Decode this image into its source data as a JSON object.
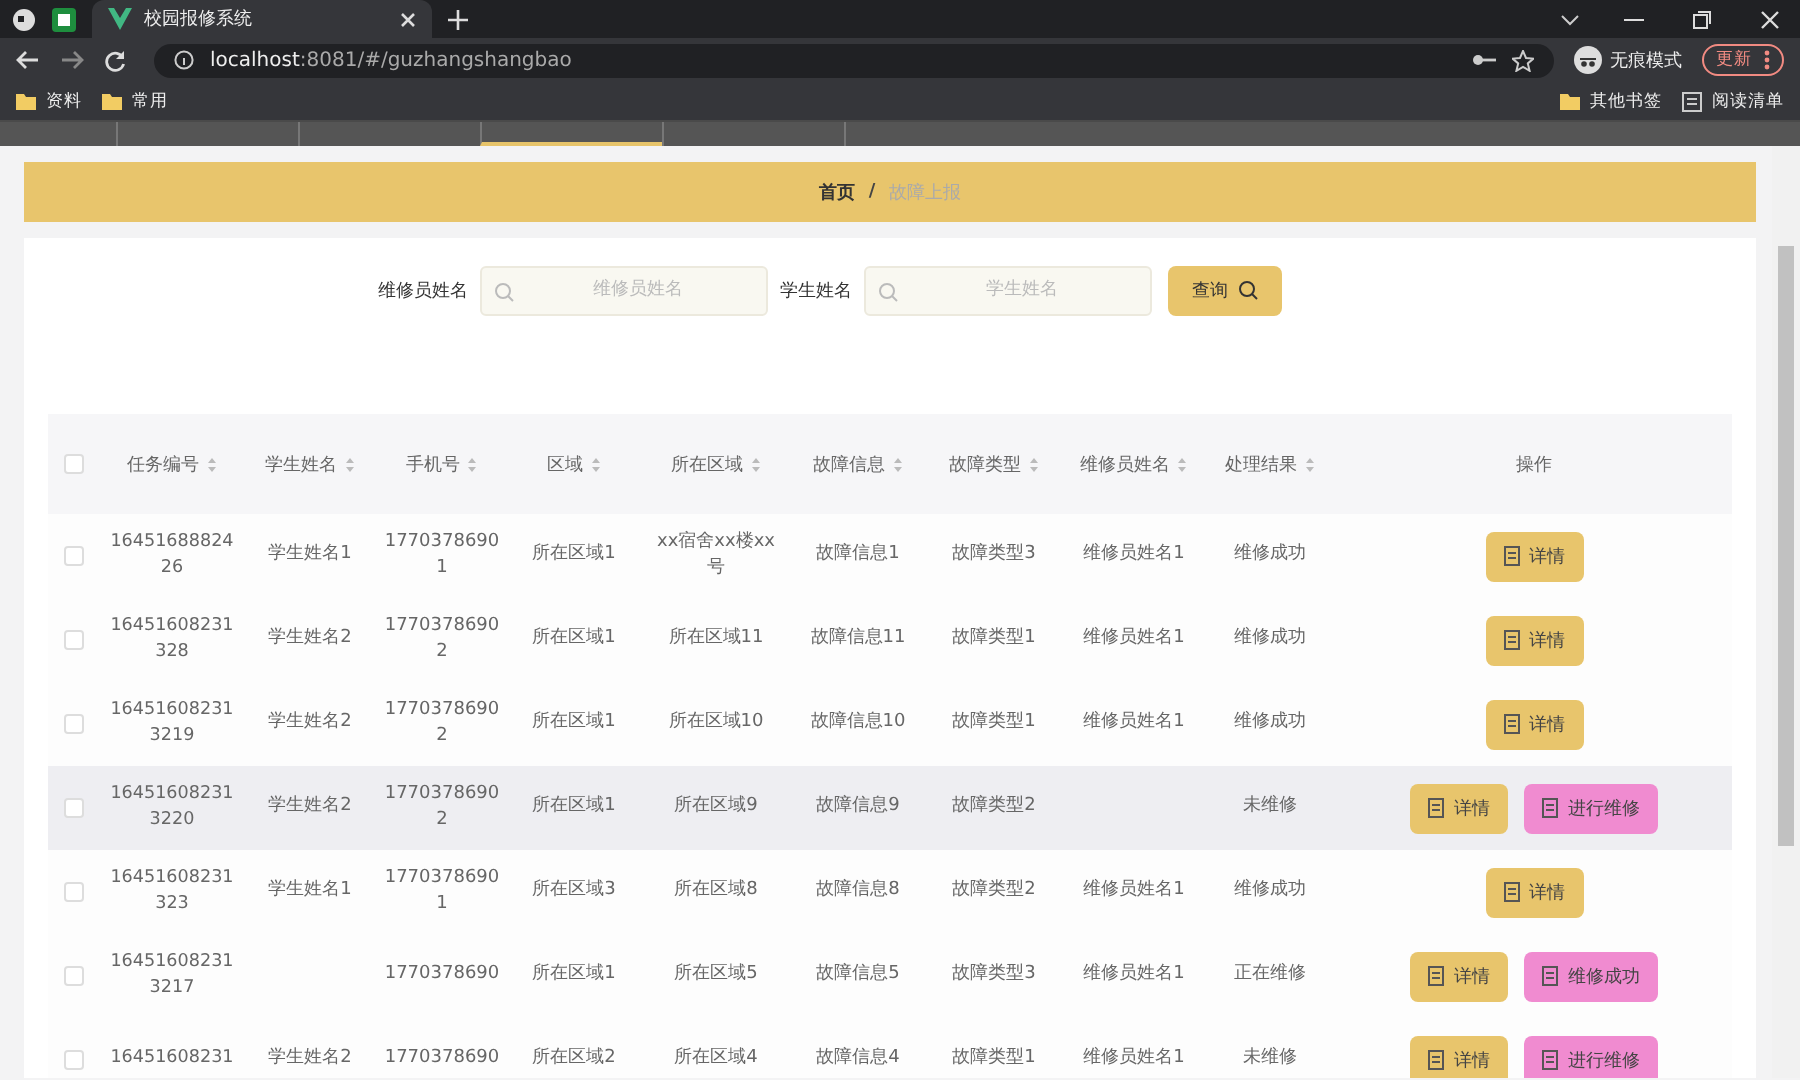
{
  "browser": {
    "tabs": [
      {
        "title": "校园报修系统",
        "selected": true
      }
    ],
    "url_host": "localhost",
    "url_rest": ":8081/#/guzhangshangbao",
    "profile_label": "无痕模式",
    "update_label": "更新",
    "bookmarks": [
      "资料",
      "常用"
    ],
    "other_bookmarks": "其他书签",
    "reading_list": "阅读清单"
  },
  "nav_tabs": [
    {
      "selected": false
    },
    {
      "selected": false
    },
    {
      "selected": true
    },
    {
      "selected": false
    },
    {
      "selected": false
    }
  ],
  "breadcrumb": {
    "items": [
      "首页",
      "故障上报"
    ],
    "separator": "/"
  },
  "search": {
    "fields": [
      {
        "label": "维修员姓名",
        "placeholder": "维修员姓名"
      },
      {
        "label": "学生姓名",
        "placeholder": "学生姓名"
      }
    ],
    "button": "查询"
  },
  "table": {
    "all_checked": false,
    "columns": [
      {
        "label": "任务编号",
        "sortable": true
      },
      {
        "label": "学生姓名",
        "sortable": true
      },
      {
        "label": "手机号",
        "sortable": true
      },
      {
        "label": "区域",
        "sortable": true
      },
      {
        "label": "所在区域",
        "sortable": true
      },
      {
        "label": "故障信息",
        "sortable": true
      },
      {
        "label": "故障类型",
        "sortable": true
      },
      {
        "label": "维修员姓名",
        "sortable": true
      },
      {
        "label": "处理结果",
        "sortable": true
      },
      {
        "label": "操作",
        "sortable": false
      }
    ],
    "rows": [
      {
        "checked": false,
        "hover": false,
        "cells": [
          "1645168882426",
          "学生姓名1",
          "17703786901",
          "所在区域1",
          "xx宿舍xx楼xx号",
          "故障信息1",
          "故障类型3",
          "维修员姓名1",
          "维修成功"
        ],
        "actions": [
          {
            "label": "详情",
            "kind": "detail"
          }
        ]
      },
      {
        "checked": false,
        "hover": false,
        "cells": [
          "16451608231328",
          "学生姓名2",
          "17703786902",
          "所在区域1",
          "所在区域11",
          "故障信息11",
          "故障类型1",
          "维修员姓名1",
          "维修成功"
        ],
        "actions": [
          {
            "label": "详情",
            "kind": "detail"
          }
        ]
      },
      {
        "checked": false,
        "hover": false,
        "cells": [
          "164516082313219",
          "学生姓名2",
          "17703786902",
          "所在区域1",
          "所在区域10",
          "故障信息10",
          "故障类型1",
          "维修员姓名1",
          "维修成功"
        ],
        "actions": [
          {
            "label": "详情",
            "kind": "detail"
          }
        ]
      },
      {
        "checked": false,
        "hover": true,
        "cells": [
          "164516082313220",
          "学生姓名2",
          "17703786902",
          "所在区域1",
          "所在区域9",
          "故障信息9",
          "故障类型2",
          null,
          "未维修"
        ],
        "actions": [
          {
            "label": "详情",
            "kind": "detail"
          },
          {
            "label": "进行维修",
            "kind": "repair"
          }
        ]
      },
      {
        "checked": false,
        "hover": false,
        "cells": [
          "16451608231323",
          "学生姓名1",
          "17703786901",
          "所在区域3",
          "所在区域8",
          "故障信息8",
          "故障类型2",
          "维修员姓名1",
          "维修成功"
        ],
        "actions": [
          {
            "label": "详情",
            "kind": "detail"
          }
        ]
      },
      {
        "checked": false,
        "hover": false,
        "cells": [
          "164516082313217",
          null,
          "1770378690",
          "所在区域1",
          "所在区域5",
          "故障信息5",
          "故障类型3",
          "维修员姓名1",
          "正在维修"
        ],
        "actions": [
          {
            "label": "详情",
            "kind": "detail"
          },
          {
            "label": "维修成功",
            "kind": "repair"
          }
        ]
      },
      {
        "checked": false,
        "hover": false,
        "cells": [
          "16451608231",
          "学生姓名2",
          "1770378690",
          "所在区域2",
          "所在区域4",
          "故障信息4",
          "故障类型1",
          "维修员姓名1",
          "未维修"
        ],
        "actions": [
          {
            "label": "详情",
            "kind": "detail"
          },
          {
            "label": "进行维修",
            "kind": "repair"
          }
        ]
      }
    ]
  }
}
